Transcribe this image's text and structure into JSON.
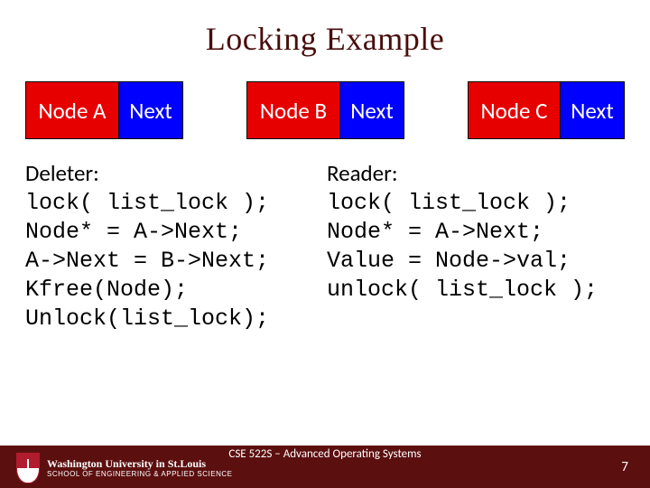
{
  "title": "Locking Example",
  "nodes": [
    {
      "name": "Node A",
      "next": "Next"
    },
    {
      "name": "Node B",
      "next": "Next"
    },
    {
      "name": "Node C",
      "next": "Next"
    }
  ],
  "deleter": {
    "title": "Deleter:",
    "lines": [
      "lock( list_lock );",
      "Node* = A->Next;",
      "A->Next = B->Next;",
      "Kfree(Node);",
      "Unlock(list_lock);"
    ]
  },
  "reader": {
    "title": "Reader:",
    "lines": [
      "lock( list_lock );",
      "Node* = A->Next;",
      "Value = Node->val;",
      "unlock( list_lock );"
    ]
  },
  "footer": {
    "course": "CSE 522S – Advanced Operating Systems",
    "page": "7",
    "logo_top": "Washington University in St.Louis",
    "logo_bottom": "SCHOOL OF ENGINEERING & APPLIED SCIENCE"
  }
}
